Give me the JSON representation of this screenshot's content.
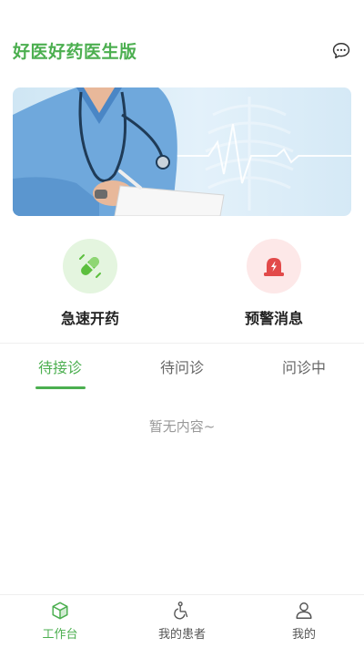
{
  "header": {
    "title": "好医好药医生版",
    "message_icon": "chat-bubble-icon"
  },
  "banner": {
    "image": "doctor-with-stethoscope-and-clipboard"
  },
  "quick_actions": [
    {
      "label": "急速开药",
      "icon": "pill-icon",
      "color": "#5cbf3e"
    },
    {
      "label": "预警消息",
      "icon": "alarm-light-icon",
      "color": "#e24a4a"
    }
  ],
  "tabs": [
    {
      "label": "待接诊",
      "active": true
    },
    {
      "label": "待问诊",
      "active": false
    },
    {
      "label": "问诊中",
      "active": false
    }
  ],
  "empty_text": "暂无内容~",
  "tabbar": [
    {
      "label": "工作台",
      "icon": "cube-icon",
      "active": true
    },
    {
      "label": "我的患者",
      "icon": "wheelchair-icon",
      "active": false
    },
    {
      "label": "我的",
      "icon": "person-icon",
      "active": false
    }
  ],
  "colors": {
    "accent": "#4caf50",
    "alert": "#e24a4a",
    "muted": "#999999"
  }
}
